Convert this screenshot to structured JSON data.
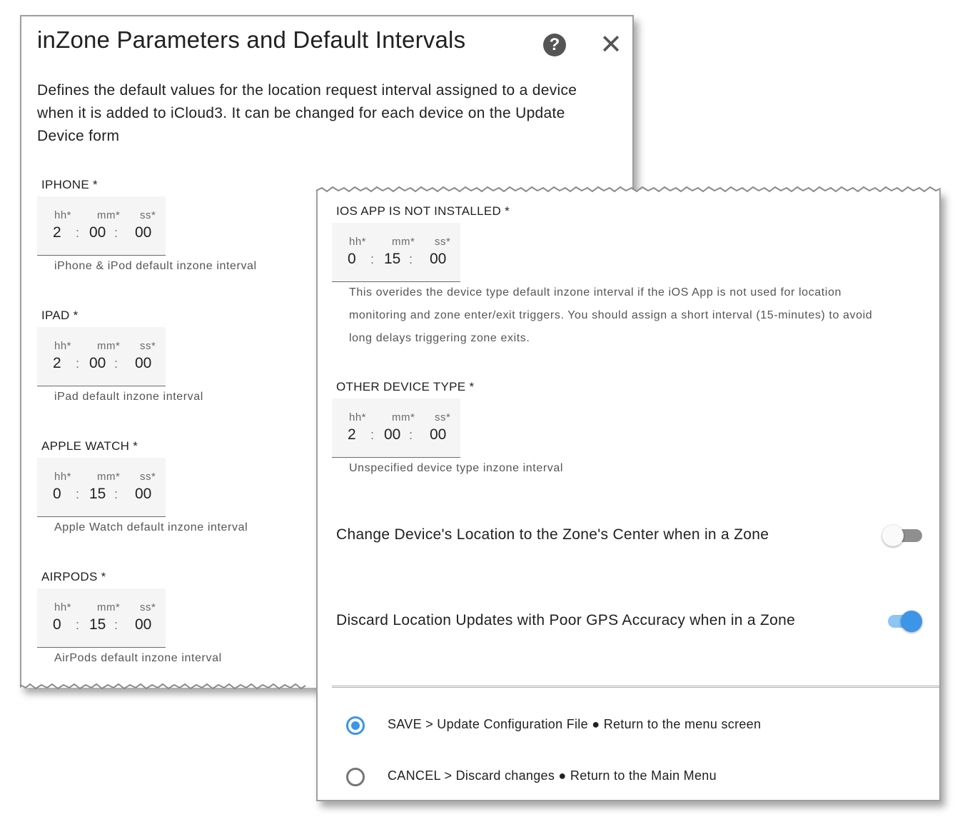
{
  "dialog": {
    "title": "inZone Parameters and Default Intervals",
    "help_icon": "?",
    "close_icon": "✕",
    "description": "Defines the default values for the location request interval assigned to a device when it is added to iCloud3. It can be changed for each device on the Update Device form"
  },
  "duration_headers": {
    "hh": "hh*",
    "mm": "mm*",
    "ss": "ss*",
    "separator": ":"
  },
  "fields": {
    "iphone": {
      "label": "IPHONE *",
      "hh": "2",
      "mm": "00",
      "ss": "00",
      "helper": "iPhone & iPod default inzone interval"
    },
    "ipad": {
      "label": "IPAD *",
      "hh": "2",
      "mm": "00",
      "ss": "00",
      "helper": "iPad default inzone interval"
    },
    "watch": {
      "label": "APPLE WATCH *",
      "hh": "0",
      "mm": "15",
      "ss": "00",
      "helper": "Apple Watch default inzone interval"
    },
    "airpods": {
      "label": "AIRPODS *",
      "hh": "0",
      "mm": "15",
      "ss": "00",
      "helper": "AirPods default inzone interval"
    },
    "no_ios_app": {
      "label": "IOS APP IS NOT INSTALLED *",
      "hh": "0",
      "mm": "15",
      "ss": "00",
      "helper_lines": [
        "This overides the device type default inzone interval if the iOS App is not used for location",
        "monitoring and zone enter/exit triggers. You should assign a short interval (15-minutes) to avoid",
        "long delays triggering zone exits."
      ]
    },
    "other": {
      "label": "OTHER DEVICE TYPE *",
      "hh": "2",
      "mm": "00",
      "ss": "00",
      "helper": "Unspecified device type inzone interval"
    }
  },
  "toggles": {
    "center_in_zone": {
      "label": "Change Device's Location to the Zone's Center when in a Zone",
      "on": false
    },
    "discard_poor_gps": {
      "label": "Discard Location Updates with Poor GPS Accuracy when in a Zone",
      "on": true
    }
  },
  "actions": {
    "save": {
      "label": "SAVE > Update Configuration File ● Return to the menu screen",
      "selected": true
    },
    "cancel": {
      "label": "CANCEL > Discard changes ● Return to the Main Menu",
      "selected": false
    }
  },
  "colors": {
    "accent": "#3d95e8",
    "accent_track": "#8cc6f5",
    "field_bg": "#f5f5f5"
  }
}
